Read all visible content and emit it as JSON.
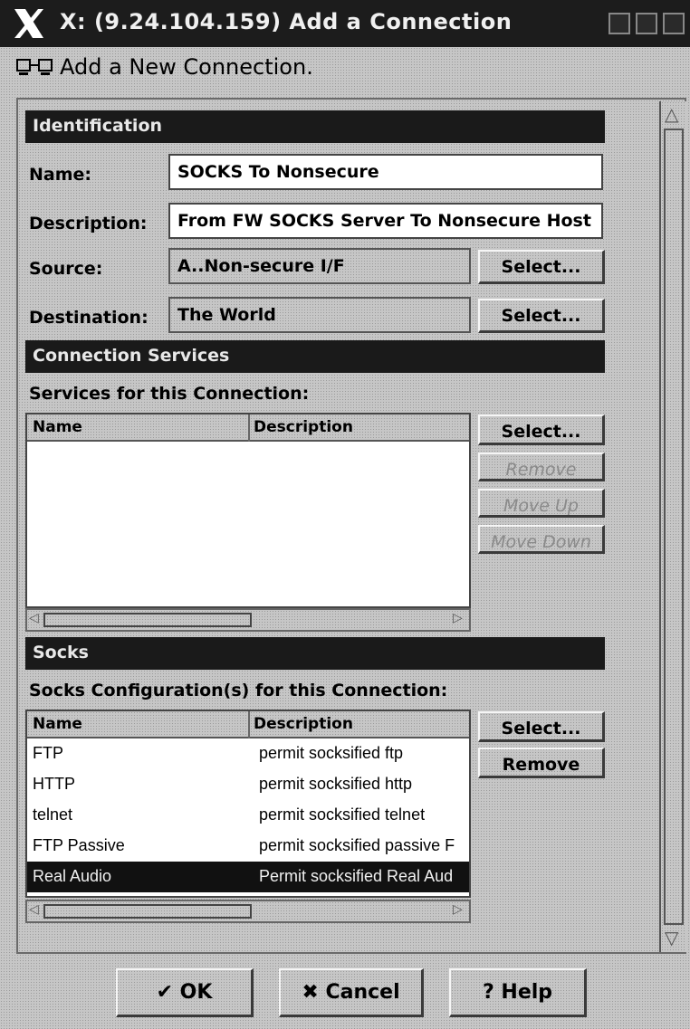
{
  "window": {
    "title": "X: (9.24.104.159) Add a Connection",
    "header": "Add a New Connection."
  },
  "identification": {
    "section_title": "Identification",
    "name_label": "Name:",
    "name_value": "SOCKS To Nonsecure",
    "description_label": "Description:",
    "description_value": "From FW SOCKS Server To Nonsecure Host",
    "source_label": "Source:",
    "source_value": "A..Non-secure I/F",
    "source_select": "Select...",
    "destination_label": "Destination:",
    "destination_value": "The World",
    "destination_select": "Select..."
  },
  "services": {
    "section_title": "Connection Services",
    "list_label": "Services for this Connection:",
    "col_name": "Name",
    "col_description": "Description",
    "select_label": "Select...",
    "remove_label": "Remove",
    "move_up_label": "Move Up",
    "move_down_label": "Move Down"
  },
  "socks": {
    "section_title": "Socks",
    "list_label": "Socks Configuration(s) for this Connection:",
    "col_name": "Name",
    "col_description": "Description",
    "select_label": "Select...",
    "remove_label": "Remove",
    "rows": [
      {
        "name": "FTP",
        "description": "permit socksified ftp"
      },
      {
        "name": "HTTP",
        "description": "permit socksified http"
      },
      {
        "name": "telnet",
        "description": "permit socksified telnet"
      },
      {
        "name": "FTP Passive",
        "description": "permit socksified passive F"
      },
      {
        "name": "Real Audio",
        "description": "Permit socksified Real Aud"
      }
    ]
  },
  "footer": {
    "ok_label": "OK",
    "cancel_label": "Cancel",
    "help_label": "Help"
  }
}
